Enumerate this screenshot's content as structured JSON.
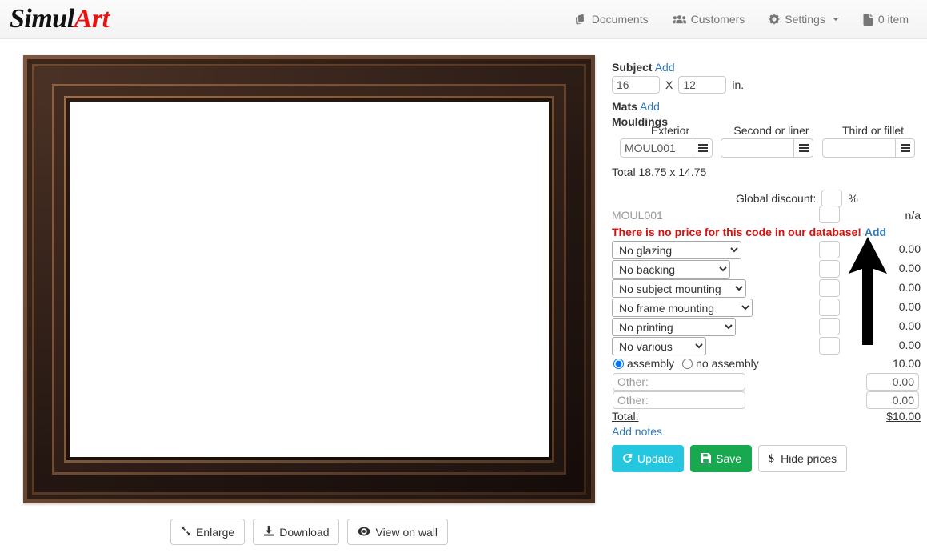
{
  "brand": {
    "part1": "Simul",
    "part2": "Art"
  },
  "nav": {
    "items": [
      {
        "label": "Documents",
        "icon": "documents-icon"
      },
      {
        "label": "Customers",
        "icon": "customers-icon"
      },
      {
        "label": "Settings",
        "icon": "gear-icon",
        "caret": true
      },
      {
        "label": "0 item",
        "icon": "file-icon"
      }
    ]
  },
  "preview": {
    "buttons": [
      {
        "label": "Enlarge",
        "icon": "expand-arrows-icon"
      },
      {
        "label": "Download",
        "icon": "download-icon"
      },
      {
        "label": "View on wall",
        "icon": "eye-icon"
      }
    ]
  },
  "panel": {
    "subject": {
      "label": "Subject",
      "add_label": "Add",
      "width_value": "16",
      "height_value": "12",
      "times": "X",
      "unit": "in."
    },
    "mats": {
      "label": "Mats",
      "add_label": "Add"
    },
    "mouldings": {
      "label": "Mouldings",
      "columns": [
        {
          "header": "Exterior",
          "value": "MOUL001"
        },
        {
          "header": "Second or liner",
          "value": ""
        },
        {
          "header": "Third or fillet",
          "value": ""
        }
      ]
    },
    "total_size": "Total 18.75 x 14.75",
    "global_discount": {
      "label": "Global discount:",
      "value": "",
      "unit": "%"
    },
    "moulding_line": {
      "code": "MOUL001",
      "qty": "",
      "price": "n/a"
    },
    "error": {
      "text": "There is no price for this code in our database!",
      "add_label": "Add"
    },
    "options": [
      {
        "name": "glazing",
        "selected": "No glazing",
        "qty": "",
        "price": "0.00"
      },
      {
        "name": "backing",
        "selected": "No backing",
        "qty": "",
        "price": "0.00"
      },
      {
        "name": "subject-mounting",
        "selected": "No subject mounting",
        "qty": "",
        "price": "0.00"
      },
      {
        "name": "frame-mounting",
        "selected": "No frame mounting",
        "qty": "",
        "price": "0.00"
      },
      {
        "name": "printing",
        "selected": "No printing",
        "qty": "",
        "price": "0.00"
      },
      {
        "name": "various",
        "selected": "No various",
        "qty": "",
        "price": "0.00"
      }
    ],
    "assembly": {
      "yes_label": "assembly",
      "no_label": "no assembly",
      "selected": "assembly",
      "price": "10.00"
    },
    "others": [
      {
        "placeholder": "Other:",
        "value": "",
        "price": "0.00"
      },
      {
        "placeholder": "Other:",
        "value": "",
        "price": "0.00"
      }
    ],
    "total": {
      "label": "Total:",
      "value": "$10.00"
    },
    "notes_link": "Add notes",
    "actions": [
      {
        "label": "Update",
        "icon": "refresh-icon",
        "style": "primary"
      },
      {
        "label": "Save",
        "icon": "save-icon",
        "style": "success"
      },
      {
        "label": "Hide prices",
        "icon": "dollar-icon",
        "style": "default"
      }
    ]
  },
  "annotation": {
    "type": "arrow-up",
    "color": "#000000"
  }
}
